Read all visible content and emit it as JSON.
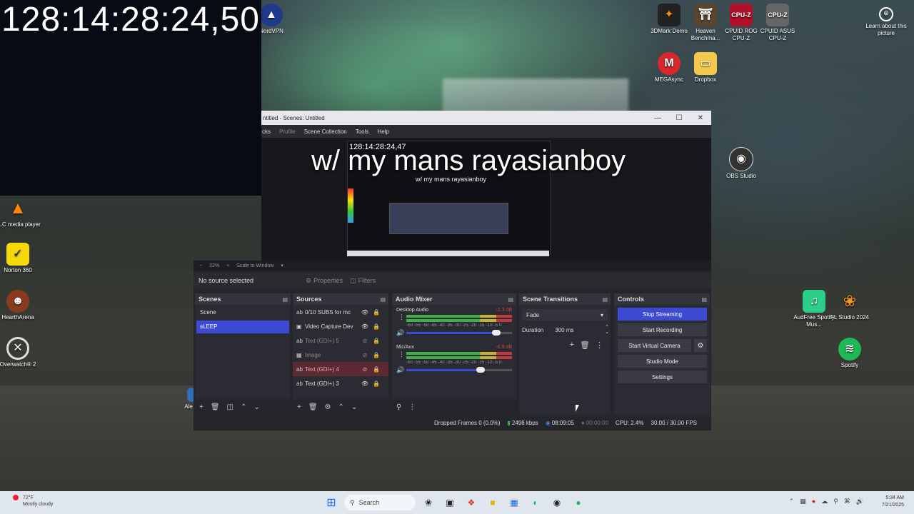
{
  "overlay": {
    "clock": "128:14:28:24,50"
  },
  "desktop_icons": [
    {
      "label": "NordVPN",
      "icon": "nordvpn-icon"
    },
    {
      "label": "3DMark Demo",
      "icon": "3dmark-icon"
    },
    {
      "label": "Heaven Benchma...",
      "icon": "heaven-benchmark-icon"
    },
    {
      "label": "CPUID ROG CPU-Z",
      "icon": "cpuz-rog-icon"
    },
    {
      "label": "CPUID ASUS CPU-Z",
      "icon": "cpuz-asus-icon"
    },
    {
      "label": "Learn about this picture",
      "icon": "learn-picture-icon"
    },
    {
      "label": "MEGAsync",
      "icon": "megasync-icon"
    },
    {
      "label": "Dropbox",
      "icon": "dropbox-icon"
    },
    {
      "label": "OBS Studio",
      "icon": "obs-studio-icon"
    },
    {
      "label": "VLC media player",
      "icon": "vlc-icon"
    },
    {
      "label": "Norton 360",
      "icon": "norton-icon"
    },
    {
      "label": "HearthArena",
      "icon": "heartharena-icon"
    },
    {
      "label": "Overwatch® 2",
      "icon": "overwatch-icon"
    },
    {
      "label": "AudFree Spotify Mus...",
      "icon": "audfree-icon"
    },
    {
      "label": "FL Studio 2024",
      "icon": "flstudio-icon"
    },
    {
      "label": "Spotify",
      "icon": "spotify-icon"
    },
    {
      "label": "Ale",
      "icon": "partial-icon"
    }
  ],
  "obs": {
    "title": "ntitled - Scenes: Untitled",
    "menu": [
      "cks",
      "Profile",
      "Scene Collection",
      "Tools",
      "Help"
    ],
    "preview": {
      "clock": "128:14:28:24,47",
      "banner": "w/ my mans rayasianboy",
      "sub": "w/ my mans rayasianboy"
    },
    "zoom": {
      "minus": "−",
      "percent": "22%",
      "plus": "+",
      "scale": "Scale to Window"
    },
    "no_source": "No source selected",
    "properties": "Properties",
    "filters": "Filters",
    "scenes": {
      "title": "Scenes",
      "items": [
        "Scene",
        "sLEEP"
      ]
    },
    "sources": {
      "title": "Sources",
      "items": [
        {
          "name": "0/10 SUBS for mc",
          "state": "normal"
        },
        {
          "name": "Video Capture Dev",
          "state": "normal"
        },
        {
          "name": "Text (GDI+) 5",
          "state": "dim"
        },
        {
          "name": "Image",
          "state": "dim"
        },
        {
          "name": "Text (GDI+) 4",
          "state": "red"
        },
        {
          "name": "Text (GDI+) 3",
          "state": "normal"
        }
      ]
    },
    "mixer": {
      "title": "Audio Mixer",
      "ticks": "-60 -55 -50 -45 -40 -35 -30 -25 -20 -15 -10 -5 0",
      "channels": [
        {
          "name": "Desktop Audio",
          "db": "-2.3 dB",
          "level": 0.85
        },
        {
          "name": "Mic/Aux",
          "db": "-6.9 dB",
          "level": 0.7
        }
      ]
    },
    "transitions": {
      "title": "Scene Transitions",
      "selected": "Fade",
      "duration_label": "Duration",
      "duration": "300 ms"
    },
    "controls": {
      "title": "Controls",
      "stop_streaming": "Stop Streaming",
      "start_recording": "Start Recording",
      "start_virtual_camera": "Start Virtual Camera",
      "studio_mode": "Studio Mode",
      "settings": "Settings"
    },
    "status": {
      "dropped": "Dropped Frames 0 (0.0%)",
      "bitrate": "2498 kbps",
      "stream_time": "08:09:05",
      "rec_time": "00:00:00",
      "cpu": "CPU: 2.4%",
      "fps": "30.00 / 30.00 FPS"
    }
  },
  "taskbar": {
    "weather_temp": "72°F",
    "weather_desc": "Mostly cloudy",
    "search": "Search",
    "time": "5:34 AM",
    "date": "7/21/2025"
  },
  "colors": {
    "accent": "#3c4ad4",
    "panel": "#2b2b33",
    "danger": "#c43a3a"
  }
}
